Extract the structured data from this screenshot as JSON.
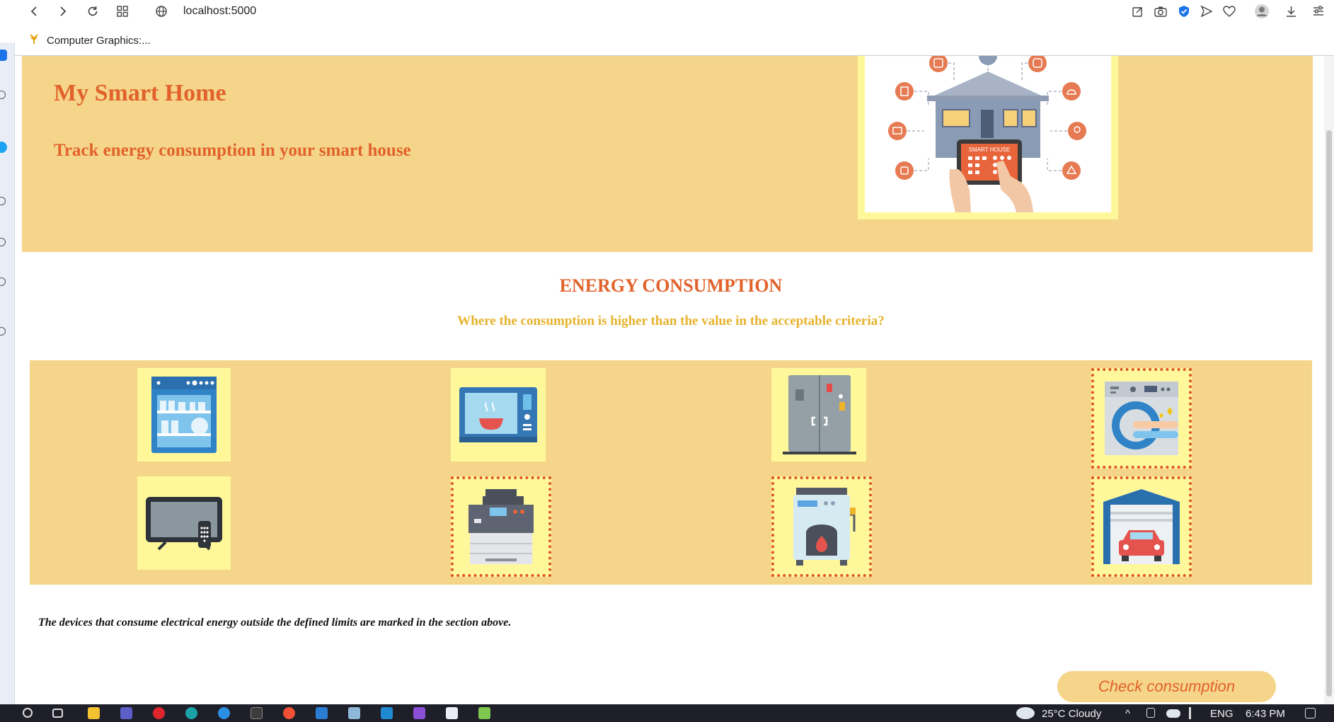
{
  "browser": {
    "url": "localhost:5000",
    "bookmark_label": "Computer Graphics:..."
  },
  "hero": {
    "title": "My Smart Home",
    "subtitle": "Track energy consumption in your smart house",
    "image_text": "SMART HOUSE"
  },
  "section": {
    "title": "ENERGY CONSUMPTION",
    "question": "Where the consumption is higher than the value in the acceptable criteria?"
  },
  "devices": [
    {
      "name": "dishwasher",
      "flagged": false
    },
    {
      "name": "microwave",
      "flagged": false
    },
    {
      "name": "refrigerator",
      "flagged": false
    },
    {
      "name": "washing machine",
      "flagged": true
    },
    {
      "name": "television",
      "flagged": false
    },
    {
      "name": "printer",
      "flagged": true
    },
    {
      "name": "boiler",
      "flagged": true
    },
    {
      "name": "garage",
      "flagged": true
    }
  ],
  "note": "The devices that consume electrical energy outside the defined limits are marked in the section above.",
  "check_button_label": "Check consumption",
  "taskbar": {
    "weather": "25°C  Cloudy",
    "language": "ENG",
    "time": "6:43 PM"
  },
  "colors": {
    "panel": "#f5d58a",
    "tile": "#fff89a",
    "accent": "#e1622b",
    "question": "#e7b32d",
    "flag_border": "#e0522a"
  }
}
